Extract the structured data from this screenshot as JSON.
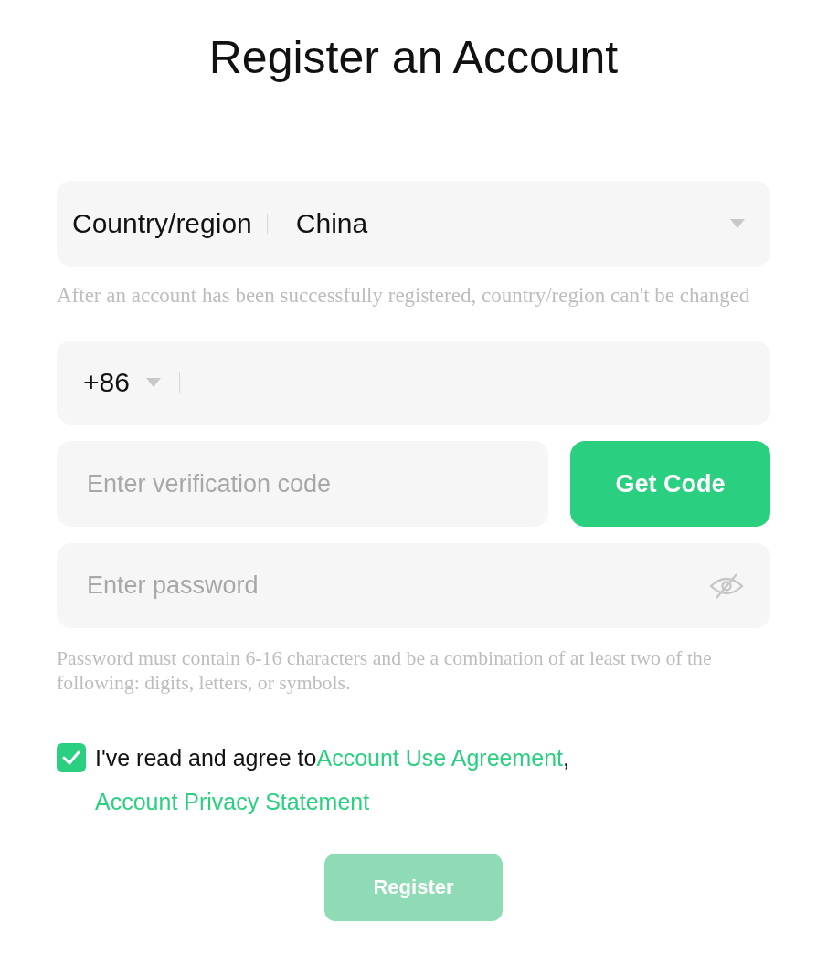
{
  "title": "Register an Account",
  "country": {
    "label": "Country/region",
    "value": "China"
  },
  "country_hint": "After an account has been successfully registered, country/region can't be changed",
  "phone": {
    "code": "+86"
  },
  "verification": {
    "placeholder": "Enter verification code",
    "button": "Get Code"
  },
  "password": {
    "placeholder": "Enter password",
    "visible": false
  },
  "password_hint": "Password must contain 6-16 characters and be a combination of at least two of the following: digits, letters, or symbols.",
  "agreement": {
    "checked": true,
    "text": "I've read and agree to",
    "links": [
      "Account Use Agreement",
      "Account Privacy Statement"
    ],
    "separator": ", "
  },
  "register": {
    "label": "Register",
    "disabled": true
  }
}
